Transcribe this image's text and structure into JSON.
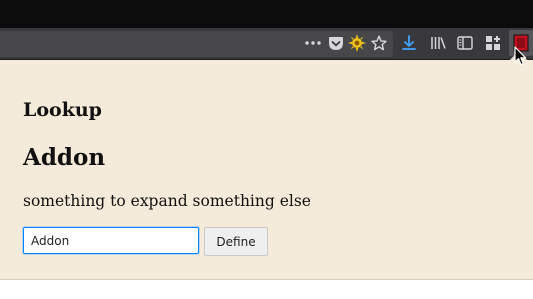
{
  "toolbar": {
    "icons": [
      {
        "name": "more-actions-icon",
        "glyph": "•••"
      },
      {
        "name": "pocket-icon"
      },
      {
        "name": "sun-extension-icon"
      },
      {
        "name": "bookmark-star-icon"
      },
      {
        "name": "downloads-icon",
        "color": "#45a1ff"
      },
      {
        "name": "library-icon"
      },
      {
        "name": "sidebar-icon"
      },
      {
        "name": "extensions-grid-icon"
      },
      {
        "name": "lookup-extension-icon",
        "color": "#c50f1f"
      }
    ]
  },
  "panel": {
    "heading": "Lookup",
    "word": "Addon",
    "definition": "something to expand something else",
    "input_value": "Addon",
    "button_label": "Define"
  },
  "colors": {
    "panel_bg": "#f5ebda",
    "toolbar_bg": "#38383d",
    "focus_ring": "#0a84ff"
  }
}
